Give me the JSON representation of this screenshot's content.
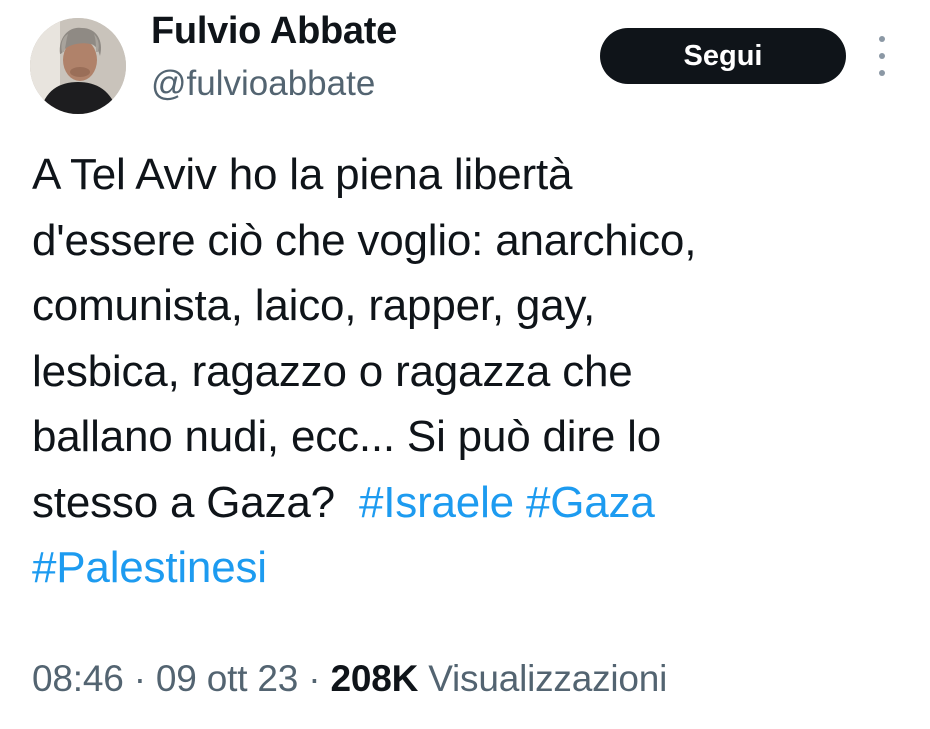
{
  "user": {
    "display_name": "Fulvio Abbate",
    "handle": "@fulvioabbate",
    "follow_label": "Segui"
  },
  "tweet": {
    "lines": [
      "A Tel Aviv ho la piena libertà",
      "d'essere ciò che voglio: anarchico,",
      "comunista, laico, rapper, gay,",
      "lesbica, ragazzo o ragazza che",
      "ballano nudi, ecc... Si può dire lo",
      "stesso a Gaza? "
    ],
    "hashtags": [
      "#Israele",
      "#Gaza",
      "#Palestinesi"
    ]
  },
  "meta": {
    "time": "08:46",
    "separator": "·",
    "date": "09 ott 23",
    "views_count": "208K",
    "views_label": "Visualizzazioni"
  },
  "icons": {
    "more": "more-vertical-icon",
    "avatar": "profile-photo"
  },
  "colors": {
    "text": "#0f1419",
    "secondary": "#536471",
    "link": "#1d9bf0",
    "button_bg": "#0f1419",
    "button_text": "#ffffff"
  }
}
